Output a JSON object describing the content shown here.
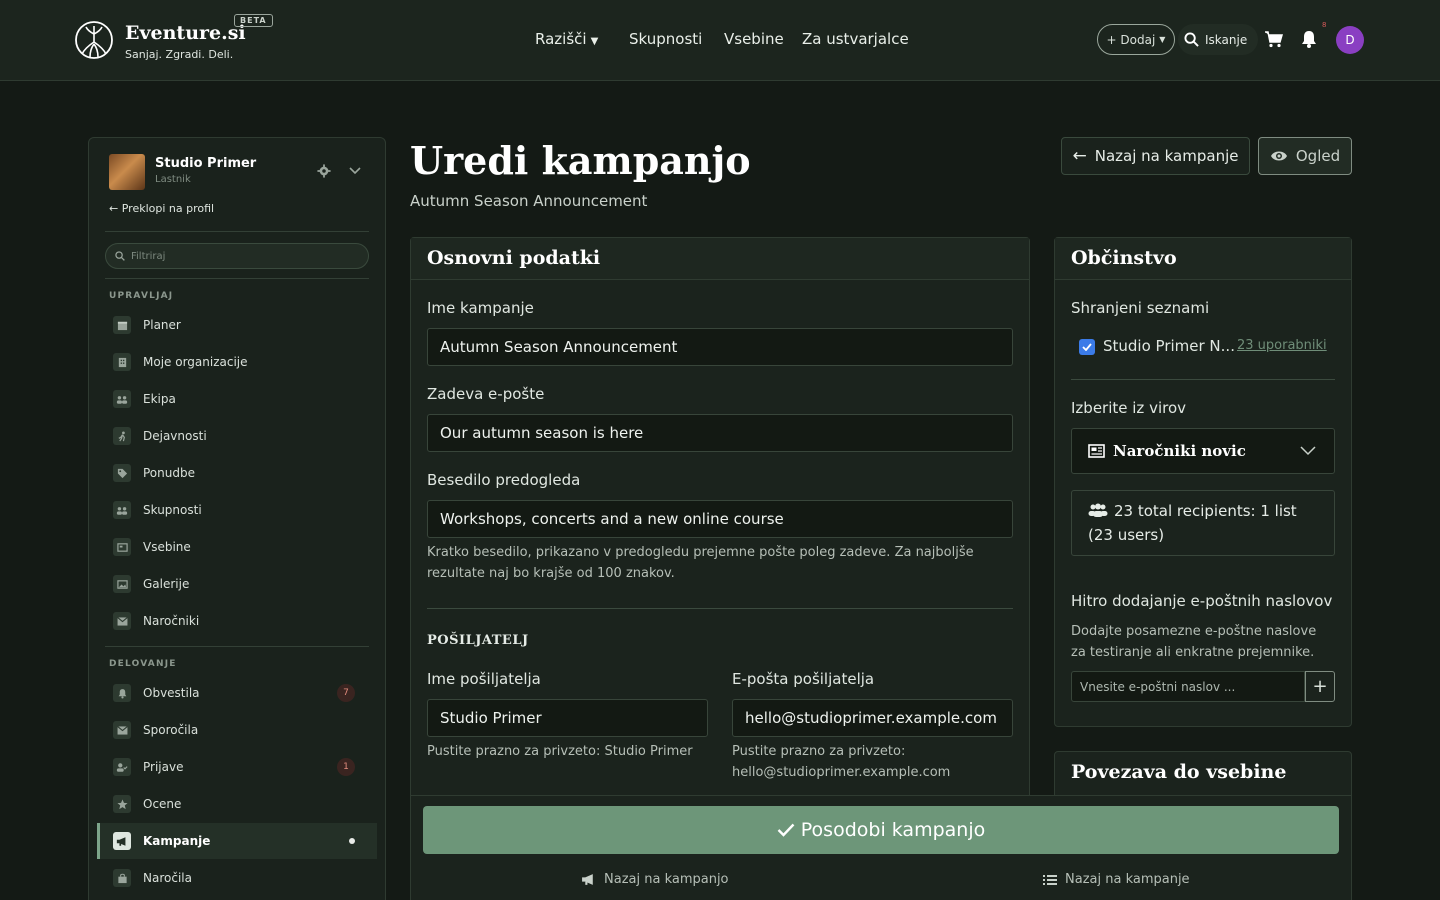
{
  "header": {
    "brand": "Eventure.si",
    "beta": "BETA",
    "tagline": "Sanjaj. Zgradi. Deli.",
    "nav": [
      {
        "label": "Razišči"
      },
      {
        "label": "Skupnosti"
      },
      {
        "label": "Vsebine"
      },
      {
        "label": "Za ustvarjalce"
      }
    ],
    "add_label": "+ Dodaj",
    "search_label": "Iskanje",
    "notif_count": "8",
    "avatar_initial": "D",
    "icons": {
      "cart": "cart-icon",
      "bell": "bell-icon",
      "search": "search-icon"
    }
  },
  "sidebar": {
    "org_name": "Studio Primer",
    "org_role": "Lastnik",
    "switch_label": "Preklopi na profil",
    "filter_placeholder": "Filtriraj",
    "section_manage": "UPRAVLJAJ",
    "section_ops": "DELOVANJE",
    "manage_items": [
      {
        "label": "Planer",
        "icon": "calendar-icon"
      },
      {
        "label": "Moje organizacije",
        "icon": "building-icon"
      },
      {
        "label": "Ekipa",
        "icon": "team-icon"
      },
      {
        "label": "Dejavnosti",
        "icon": "running-icon"
      },
      {
        "label": "Ponudbe",
        "icon": "tag-icon"
      },
      {
        "label": "Skupnosti",
        "icon": "people-icon"
      },
      {
        "label": "Vsebine",
        "icon": "newspaper-icon"
      },
      {
        "label": "Galerije",
        "icon": "images-icon"
      },
      {
        "label": "Naročniki",
        "icon": "envelope-icon"
      }
    ],
    "ops_items": [
      {
        "label": "Obvestila",
        "icon": "bell-icon",
        "badge": "7"
      },
      {
        "label": "Sporočila",
        "icon": "envelope-icon",
        "badge": ""
      },
      {
        "label": "Prijave",
        "icon": "user-check-icon",
        "badge": "1"
      },
      {
        "label": "Ocene",
        "icon": "star-icon",
        "badge": ""
      },
      {
        "label": "Kampanje",
        "icon": "megaphone-icon",
        "badge": "",
        "active": true
      },
      {
        "label": "Naročila",
        "icon": "bag-icon",
        "badge": ""
      }
    ]
  },
  "page": {
    "title": "Uredi kampanjo",
    "subtitle": "Autumn Season Announcement",
    "back_button": "Nazaj na kampanje",
    "preview_button": "Ogled"
  },
  "basic": {
    "title": "Osnovni podatki",
    "name_label": "Ime kampanje",
    "name_value": "Autumn Season Announcement",
    "subject_label": "Zadeva e-pošte",
    "subject_value": "Our autumn season is here",
    "preview_label": "Besedilo predogleda",
    "preview_value": "Workshops, concerts and a new online course",
    "preview_help": "Kratko besedilo, prikazano v predogledu prejemne pošte poleg zadeve. Za najboljše rezultate naj bo krajše od 100 znakov.",
    "sender_heading": "POŠILJATELJ",
    "sender_name_label": "Ime pošiljatelja",
    "sender_name_value": "Studio Primer",
    "sender_name_help": "Pustite prazno za privzeto: Studio Primer",
    "sender_email_label": "E-pošta pošiljatelja",
    "sender_email_value": "hello@studioprimer.example.com",
    "sender_email_help": "Pustite prazno za privzeto: hello@studioprimer.example.com"
  },
  "audience": {
    "title": "Občinstvo",
    "saved_lists_label": "Shranjeni seznami",
    "list_name": "Studio Primer N...",
    "list_users": "23 uporabniki",
    "source_label": "Izberite iz virov",
    "source_value": "Naročniki novic",
    "recipients": "23 total recipients: 1 list (23 users)",
    "quick_add_label": "Hitro dodajanje e-poštnih naslovov",
    "quick_add_help": "Dodajte posamezne e-poštne naslove za testiranje ali enkratne prejemnike.",
    "email_placeholder": "Vnesite e-poštni naslov ..."
  },
  "content_link": {
    "title": "Povezava do vsebine"
  },
  "footer": {
    "submit": "Posodobi kampanjo",
    "link_left": "Nazaj na kampanjo",
    "link_right": "Nazaj na kampanje"
  },
  "colors": {
    "accent": "#6d9679",
    "background": "#141a15",
    "avatar": "#8a3fc2",
    "checkbox": "#3b7be8"
  }
}
